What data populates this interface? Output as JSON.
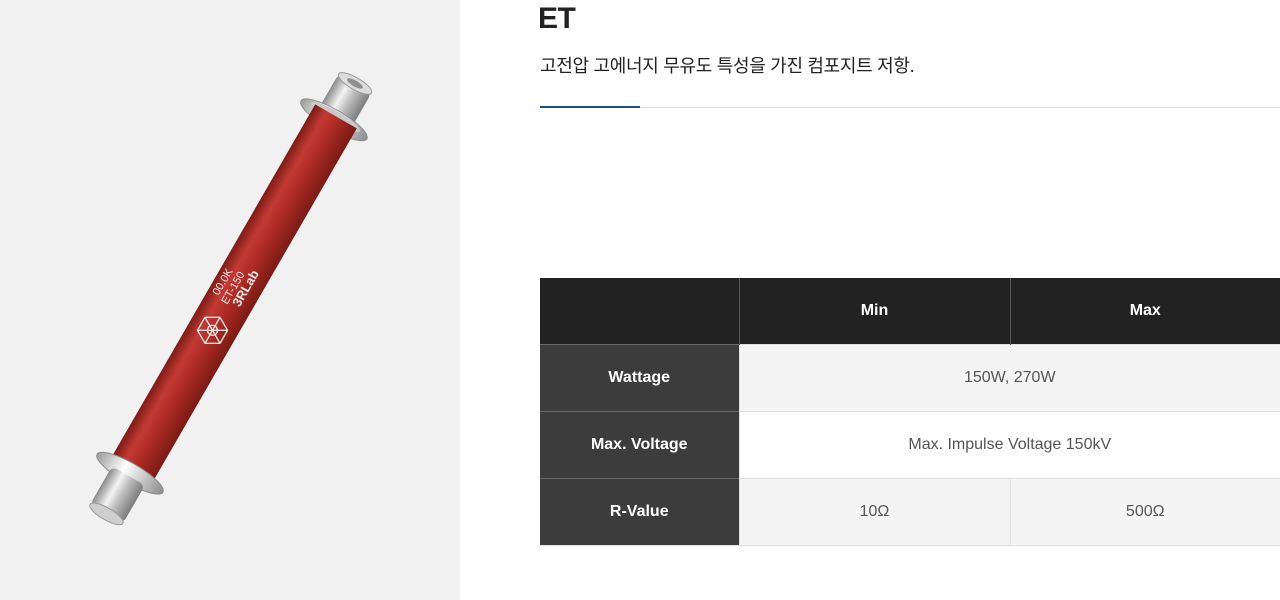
{
  "product": {
    "name": "ET",
    "description": "고전압 고에너지 무유도 특성을 가진 컴포지트 저항.",
    "image": {
      "alt": "ET high voltage composite resistor",
      "brand_text": "3RLab",
      "model_text": "ET-150",
      "value_text": "00.0K",
      "body_color": "#b32d27",
      "cap_color": "#c7c7c7"
    }
  },
  "colors": {
    "panel_bg": "#f1f1f1",
    "accent": "#1f4d86",
    "table_header_bg": "#222222",
    "table_rowhead_bg": "#3c3c3c"
  },
  "spec_table": {
    "headers": [
      "",
      "Min",
      "Max"
    ],
    "rows": [
      {
        "label": "Wattage",
        "values": [
          "150W, 270W"
        ]
      },
      {
        "label": "Max. Voltage",
        "values": [
          "Max. Impulse Voltage 150kV"
        ]
      },
      {
        "label": "R-Value",
        "values": [
          "10Ω",
          "500Ω"
        ]
      }
    ]
  }
}
